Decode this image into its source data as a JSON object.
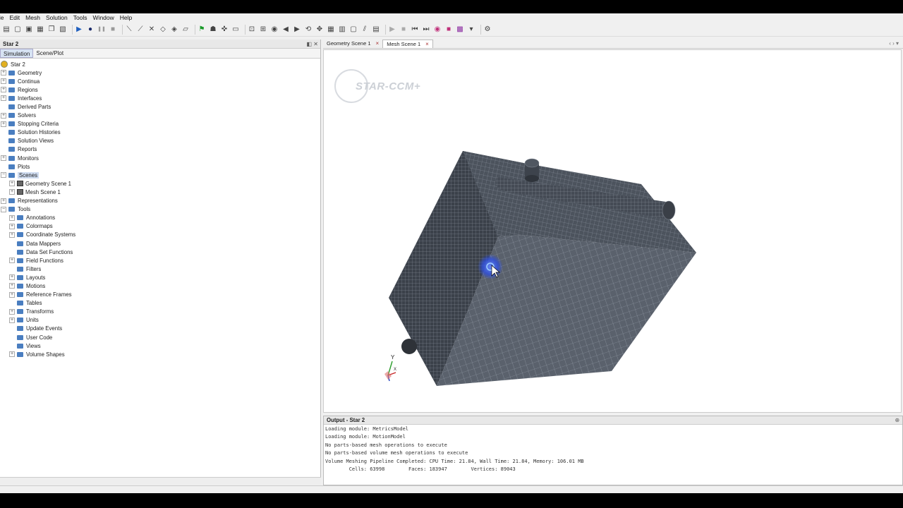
{
  "menu": [
    "ile",
    "Edit",
    "Mesh",
    "Solution",
    "Tools",
    "Window",
    "Help"
  ],
  "toolbar_icons": [
    "new-icon",
    "open-icon",
    "save-icon",
    "save-all-icon",
    "copy-icon",
    "paste-icon",
    "run-icon",
    "step-icon",
    "pause-icon",
    "stop-icon",
    "mesh-icon",
    "mesh-generate-icon",
    "clear-mesh-icon",
    "surface-mesh-icon",
    "volume-mesh-icon",
    "remesh-icon",
    "start-flag-icon",
    "figure-icon",
    "cross-tool-icon",
    "screenshot-icon",
    "fit-icon",
    "zoom-icon",
    "camera-icon",
    "back-icon",
    "forward-icon",
    "rotate-icon",
    "pan-icon",
    "grid-icon",
    "table-icon",
    "panel-icon",
    "plot-icon",
    "mesh-view-icon",
    "play-icon",
    "stop2-icon",
    "step-back-icon",
    "step-forward-icon",
    "record-icon",
    "marker-icon",
    "animate-icon",
    "tools-dropdown-icon",
    "settings-gear-icon"
  ],
  "left_panel": {
    "title": "Star 2",
    "tabs": [
      "Simulation",
      "Scene/Plot"
    ],
    "tree": [
      {
        "label": "Star 2",
        "level": 0,
        "icon": "root",
        "expander": ""
      },
      {
        "label": "Geometry",
        "level": 0,
        "icon": "folder",
        "expander": "+"
      },
      {
        "label": "Continua",
        "level": 0,
        "icon": "folder",
        "expander": "+"
      },
      {
        "label": "Regions",
        "level": 0,
        "icon": "folder",
        "expander": "+"
      },
      {
        "label": "Interfaces",
        "level": 0,
        "icon": "folder",
        "expander": "+"
      },
      {
        "label": "Derived Parts",
        "level": 0,
        "icon": "folder",
        "expander": ""
      },
      {
        "label": "Solvers",
        "level": 0,
        "icon": "folder",
        "expander": "+"
      },
      {
        "label": "Stopping Criteria",
        "level": 0,
        "icon": "folder",
        "expander": "+"
      },
      {
        "label": "Solution Histories",
        "level": 0,
        "icon": "folder",
        "expander": ""
      },
      {
        "label": "Solution Views",
        "level": 0,
        "icon": "folder",
        "expander": ""
      },
      {
        "label": "Reports",
        "level": 0,
        "icon": "folder",
        "expander": ""
      },
      {
        "label": "Monitors",
        "level": 0,
        "icon": "folder",
        "expander": "+"
      },
      {
        "label": "Plots",
        "level": 0,
        "icon": "folder",
        "expander": ""
      },
      {
        "label": "Scenes",
        "level": 0,
        "icon": "folder",
        "expander": "-",
        "selected": true
      },
      {
        "label": "Geometry Scene 1",
        "level": 1,
        "icon": "scene",
        "expander": "+"
      },
      {
        "label": "Mesh Scene 1",
        "level": 1,
        "icon": "scene",
        "expander": "+"
      },
      {
        "label": "Representations",
        "level": 0,
        "icon": "folder",
        "expander": "+"
      },
      {
        "label": "Tools",
        "level": 0,
        "icon": "folder",
        "expander": "-"
      },
      {
        "label": "Annotations",
        "level": 1,
        "icon": "folder",
        "expander": "+"
      },
      {
        "label": "Colormaps",
        "level": 1,
        "icon": "folder",
        "expander": "+"
      },
      {
        "label": "Coordinate Systems",
        "level": 1,
        "icon": "folder",
        "expander": "+"
      },
      {
        "label": "Data Mappers",
        "level": 1,
        "icon": "folder",
        "expander": ""
      },
      {
        "label": "Data Set Functions",
        "level": 1,
        "icon": "folder",
        "expander": ""
      },
      {
        "label": "Field Functions",
        "level": 1,
        "icon": "folder",
        "expander": "+"
      },
      {
        "label": "Filters",
        "level": 1,
        "icon": "folder",
        "expander": ""
      },
      {
        "label": "Layouts",
        "level": 1,
        "icon": "folder",
        "expander": "+"
      },
      {
        "label": "Motions",
        "level": 1,
        "icon": "folder",
        "expander": "+"
      },
      {
        "label": "Reference Frames",
        "level": 1,
        "icon": "folder",
        "expander": "+"
      },
      {
        "label": "Tables",
        "level": 1,
        "icon": "folder",
        "expander": ""
      },
      {
        "label": "Transforms",
        "level": 1,
        "icon": "folder",
        "expander": "+"
      },
      {
        "label": "Units",
        "level": 1,
        "icon": "folder",
        "expander": "+"
      },
      {
        "label": "Update Events",
        "level": 1,
        "icon": "folder",
        "expander": ""
      },
      {
        "label": "User Code",
        "level": 1,
        "icon": "folder",
        "expander": ""
      },
      {
        "label": "Views",
        "level": 1,
        "icon": "folder",
        "expander": ""
      },
      {
        "label": "Volume Shapes",
        "level": 1,
        "icon": "folder",
        "expander": "+"
      }
    ]
  },
  "scene_tabs": [
    {
      "label": "Geometry Scene 1",
      "active": false
    },
    {
      "label": "Mesh Scene 1",
      "active": true
    }
  ],
  "viewport": {
    "logo_text": "STAR-CCM+",
    "axis_labels": {
      "y": "Y",
      "x": "X"
    }
  },
  "output": {
    "title": "Output - Star 2",
    "lines": [
      "Loading module: MetricsModel",
      "Loading module: MotionModel",
      "No parts-based mesh operations to execute",
      "No parts-based volume mesh operations to execute",
      "Volume Meshing Pipeline Completed: CPU Time: 21.84, Wall Time: 21.84, Memory: 106.01 MB",
      "        Cells: 63998        Faces: 183947        Vertices: 89043"
    ]
  },
  "colors": {
    "mesh_face_dark": "#3b414a",
    "mesh_face_front": "#5a616c",
    "mesh_face_top": "#4c535d",
    "mesh_line": "#9aa2ad",
    "selection": "#cfdcf0"
  }
}
